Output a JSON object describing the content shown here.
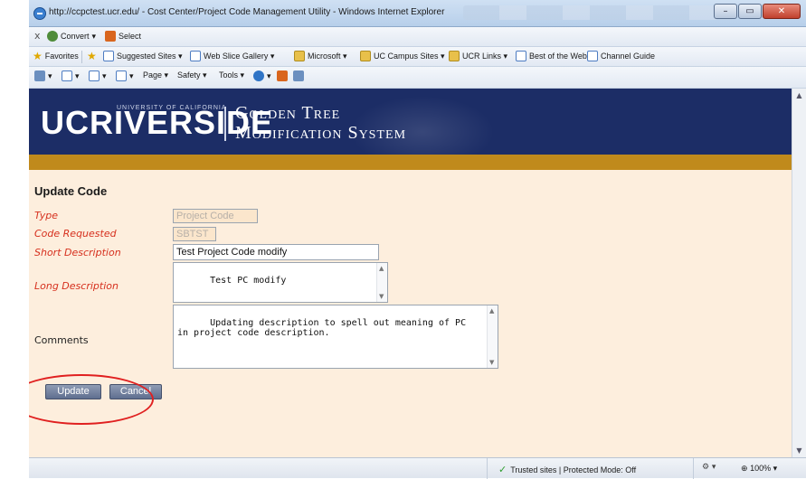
{
  "window": {
    "title": "http://ccpctest.ucr.edu/ - Cost Center/Project Code Management Utility - Windows Internet Explorer",
    "controls": {
      "minimize": "–",
      "maximize": "▭",
      "close": "✕"
    }
  },
  "toolbar_row1": {
    "close_glyph": "x",
    "convert_label": "Convert",
    "select_label": "Select"
  },
  "favorites_bar": {
    "favorites_label": "Favorites",
    "items": [
      "Suggested Sites ▾",
      "Web Slice Gallery ▾",
      "Microsoft ▾",
      "UC Campus Sites ▾",
      "UCR Links ▾",
      "Best of the Web",
      "Channel Guide"
    ]
  },
  "command_bar": {
    "page_label": "Page ▾",
    "safety_label": "Safety ▾",
    "tools_label": "Tools ▾",
    "help_label": "▾"
  },
  "banner": {
    "logo_text": "UCRIVERSIDE",
    "logo_tagline": "UNIVERSITY OF CALIFORNIA",
    "app_title_line1": "Golden Tree",
    "app_title_line2": "Modification System"
  },
  "form": {
    "title": "Update Code",
    "fields": {
      "type": {
        "label": "Type",
        "value": "Project Code"
      },
      "code_requested": {
        "label": "Code Requested",
        "value": "SBTST"
      },
      "short_description": {
        "label": "Short Description",
        "value": "Test Project Code modify"
      },
      "long_description": {
        "label": "Long Description",
        "value": "Test PC modify"
      },
      "comments": {
        "label": "Comments",
        "value": "Updating description to spell out meaning of PC\nin project code description."
      }
    },
    "buttons": {
      "update": "Update",
      "cancel": "Cancel"
    }
  },
  "status_bar": {
    "trusted_text": "Trusted sites | Protected Mode: Off",
    "zoom_text": "100%",
    "zoom_glyph": "⊕",
    "misc_glyph": "⚙ ▾"
  },
  "colors": {
    "banner_navy": "#1c2d66",
    "gold_band": "#c08a1c",
    "content_bg": "#fdeedd",
    "label_red": "#d6301e",
    "annotation_red": "#e02020"
  }
}
